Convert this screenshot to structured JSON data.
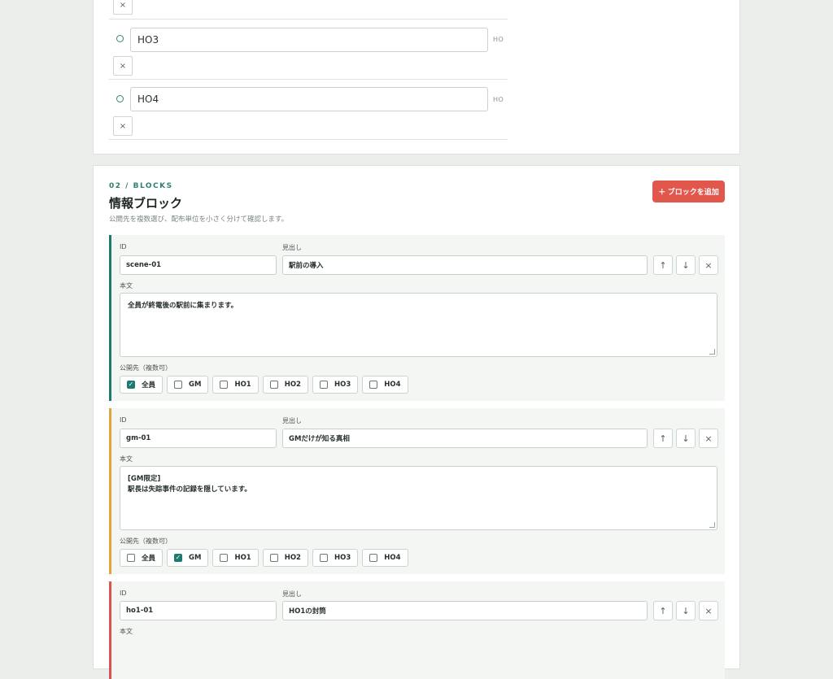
{
  "handouts": [
    {
      "value": "HO3",
      "tag": "HO",
      "remove": "×"
    },
    {
      "value": "HO4",
      "tag": "HO",
      "remove": "×"
    }
  ],
  "top_remove": "×",
  "section": {
    "eyebrow": "02 / BLOCKS",
    "title": "情報ブロック",
    "subtitle": "公開先を複数選び、配布単位を小さく分けて確認します。",
    "add_button": "＋ ブロックを追加"
  },
  "labels": {
    "id": "ID",
    "heading": "見出し",
    "body": "本文",
    "visibility": "公開先（複数可）"
  },
  "controls": {
    "up": "↑",
    "down": "↓",
    "remove": "×"
  },
  "audiences": [
    "全員",
    "GM",
    "HO1",
    "HO2",
    "HO3",
    "HO4"
  ],
  "colors": {
    "teal": "#1e7a6e",
    "amber": "#e0a43a",
    "red": "#d9534f",
    "accent": "#e2574c"
  },
  "blocks": [
    {
      "id": "scene-01",
      "heading": "駅前の導入",
      "body": "全員が終電後の駅前に集まります。",
      "checked": [
        true,
        false,
        false,
        false,
        false,
        false
      ]
    },
    {
      "id": "gm-01",
      "heading": "GMだけが知る真相",
      "body": "[GM限定]\n駅長は失踪事件の記録を隠しています。",
      "checked": [
        false,
        true,
        false,
        false,
        false,
        false
      ]
    },
    {
      "id": "ho1-01",
      "heading": "HO1の封筒"
    }
  ]
}
